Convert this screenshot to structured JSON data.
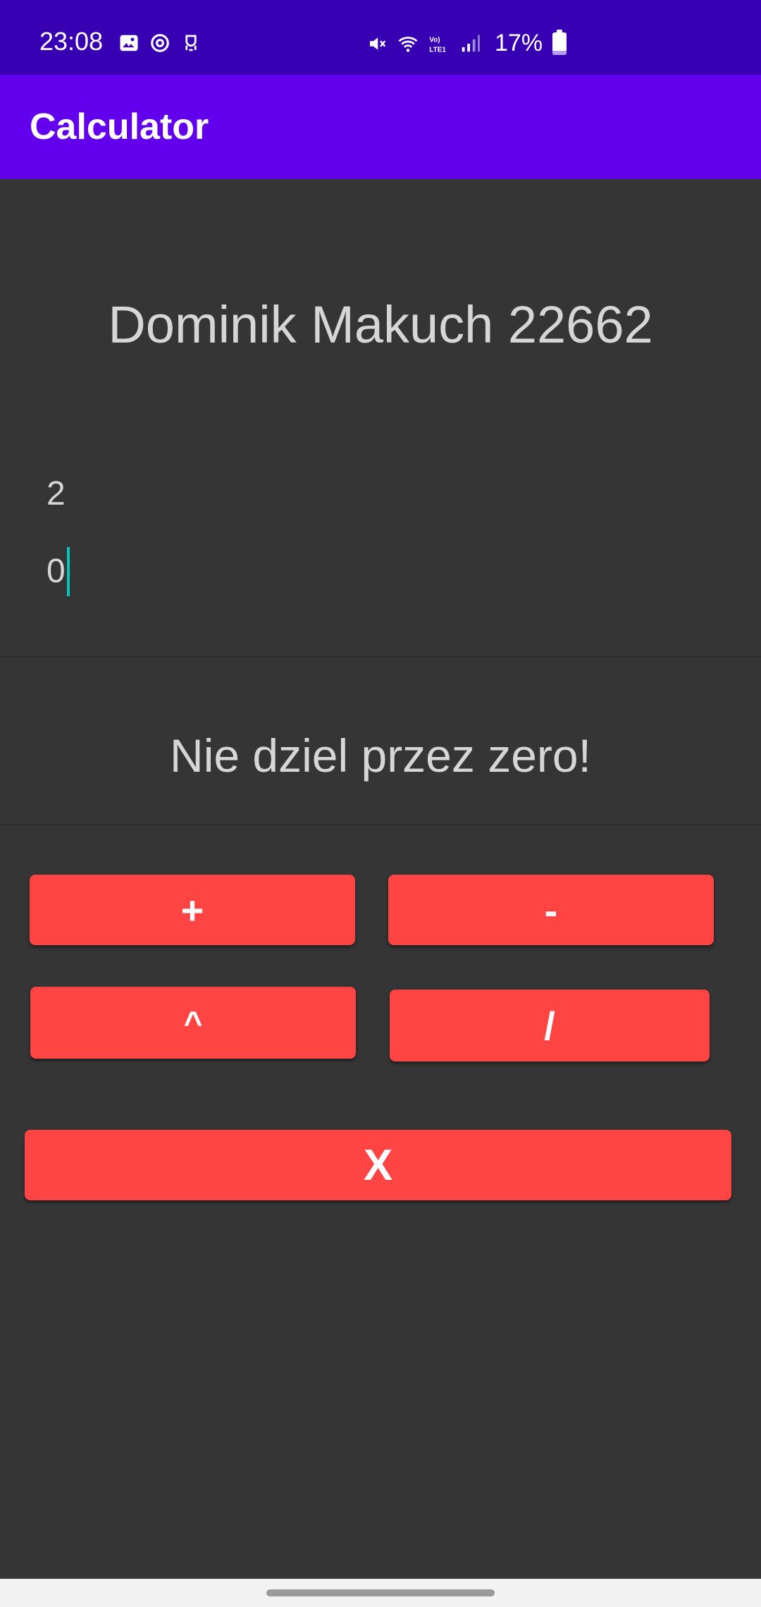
{
  "status_bar": {
    "time": "23:08",
    "battery_text": "17%",
    "battery_level": 0.17,
    "icons_left": [
      "gallery-icon",
      "sync-icon",
      "bot-icon"
    ],
    "icons_right": [
      "mute-icon",
      "wifi-icon",
      "volte-icon",
      "signal-icon",
      "battery-icon"
    ]
  },
  "app_bar": {
    "title": "Calculator"
  },
  "main": {
    "author_label": "Dominik Makuch 22662",
    "first_number": "2",
    "second_number": "0",
    "result_message": "Nie dziel przez zero!"
  },
  "buttons": {
    "add": "+",
    "subtract": "-",
    "power": "^",
    "divide": "/",
    "multiply": "X"
  },
  "colors": {
    "status_bar": "#3700b3",
    "app_bar": "#6200ee",
    "background": "#353535",
    "button": "#ff4444",
    "cursor": "#00c9b7"
  }
}
